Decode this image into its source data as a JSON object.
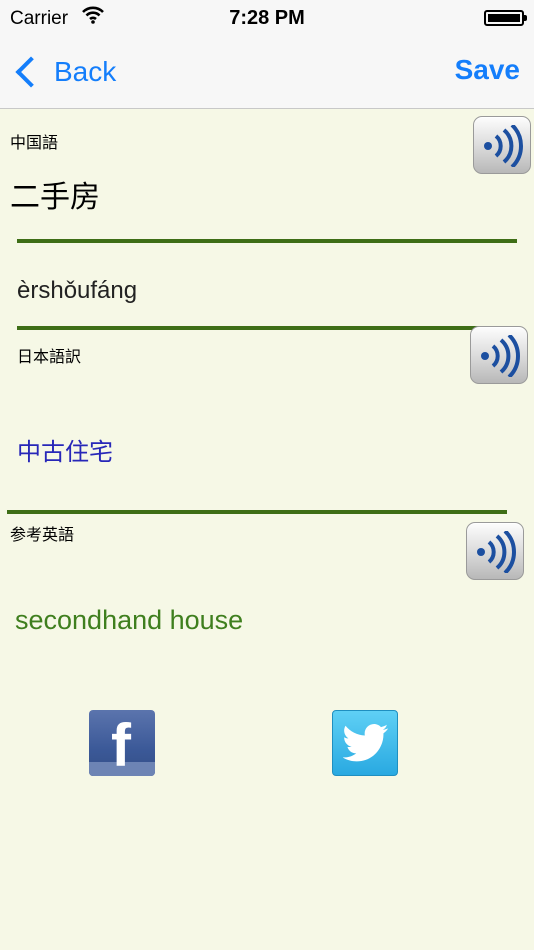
{
  "status_bar": {
    "carrier": "Carrier",
    "time": "7:28 PM"
  },
  "nav": {
    "back_label": "Back",
    "save_label": "Save"
  },
  "chinese_section": {
    "label": "中国語",
    "word": "二手房",
    "pinyin": "èrshǒufáng"
  },
  "japanese_section": {
    "label": "日本語訳",
    "translation": "中古住宅"
  },
  "english_section": {
    "label": "参考英語",
    "translation": "secondhand house"
  },
  "colors": {
    "background": "#f6f8e6",
    "accent_blue": "#147efb",
    "divider_green": "#3e6e16",
    "japanese_text": "#2727b8",
    "english_text": "#3f7f1e"
  },
  "icons": {
    "speaker": "speaker-icon",
    "facebook": "facebook-icon",
    "twitter": "twitter-icon",
    "wifi": "wifi-icon",
    "battery": "battery-icon"
  }
}
